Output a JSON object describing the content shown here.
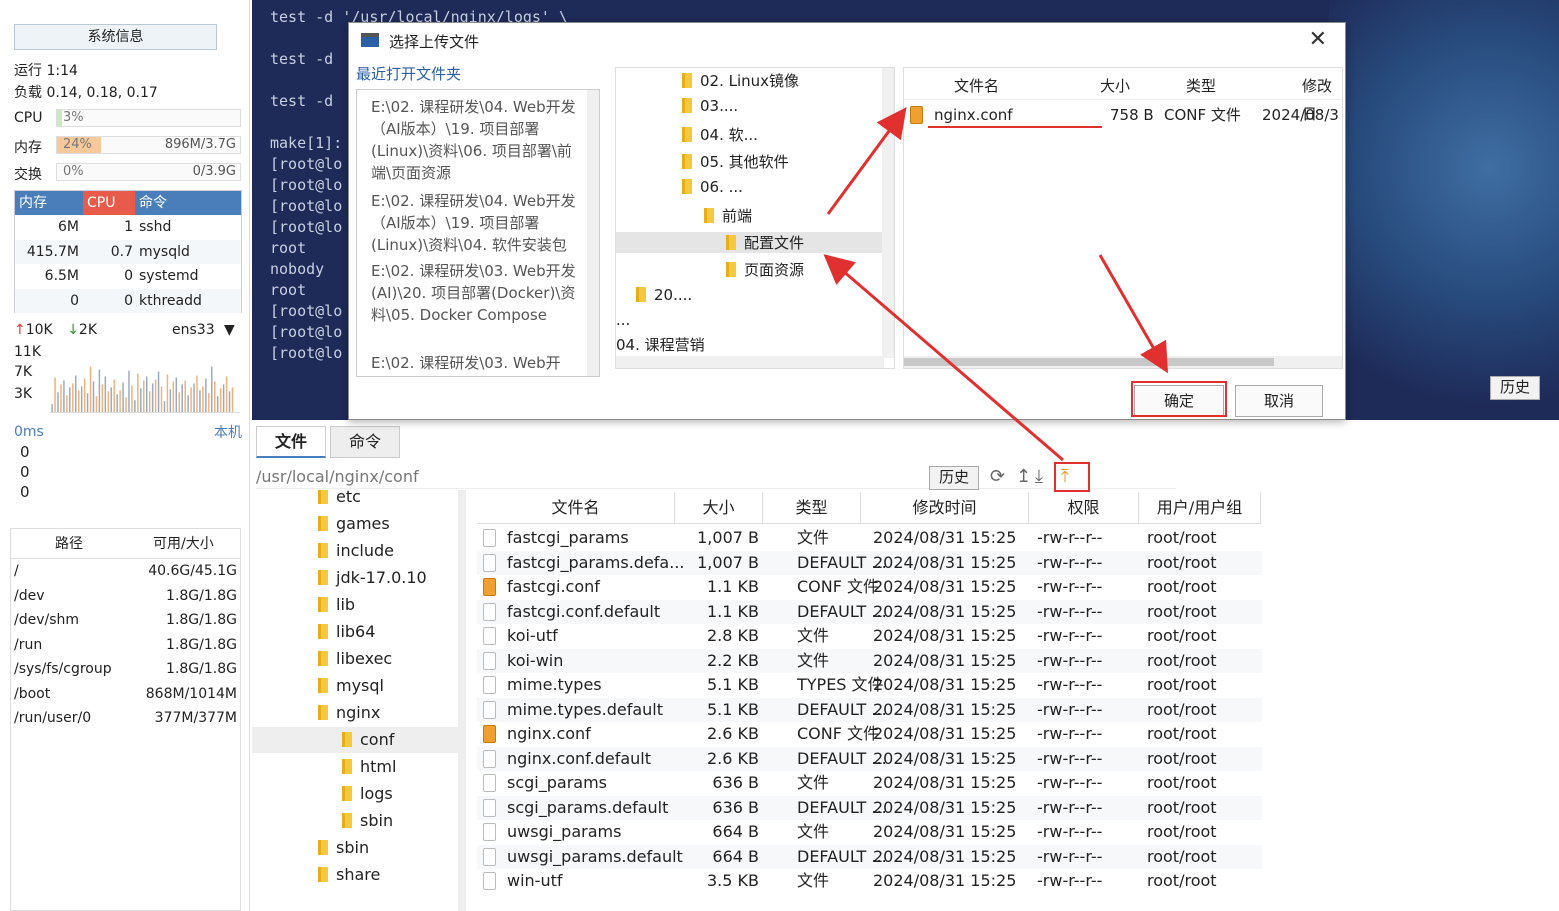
{
  "left": {
    "sysinfo_label": "系统信息",
    "uptime": "运行 1:14",
    "load": "负载 0.14, 0.18, 0.17",
    "cpu": {
      "label": "CPU",
      "pct": "3%",
      "fill": 0.03
    },
    "mem": {
      "label": "内存",
      "pct": "24%",
      "val": "896M/3.7G",
      "fill": 0.24
    },
    "swap": {
      "label": "交换",
      "pct": "0%",
      "val": "0/3.9G",
      "fill": 0
    },
    "proc_headers": [
      "内存",
      "CPU",
      "命令"
    ],
    "procs": [
      [
        "6M",
        "1",
        "sshd"
      ],
      [
        "415.7M",
        "0.7",
        "mysqld"
      ],
      [
        "6.5M",
        "0",
        "systemd"
      ],
      [
        "0",
        "0",
        "kthreadd"
      ]
    ],
    "net_up": "10K",
    "net_down": "2K",
    "iface": "ens33",
    "graph_ticks": [
      "11K",
      "7K",
      "3K"
    ],
    "ping": "0ms",
    "ping_host": "本机",
    "ping_vals": [
      "0",
      "0",
      "0"
    ],
    "disk_headers": [
      "路径",
      "可用/大小"
    ],
    "disks": [
      [
        "/",
        "40.6G/45.1G"
      ],
      [
        "/dev",
        "1.8G/1.8G"
      ],
      [
        "/dev/shm",
        "1.8G/1.8G"
      ],
      [
        "/run",
        "1.8G/1.8G"
      ],
      [
        "/sys/fs/cgroup",
        "1.8G/1.8G"
      ],
      [
        "/boot",
        "868M/1014M"
      ],
      [
        "/run/user/0",
        "377M/377M"
      ]
    ]
  },
  "terminal": {
    "lines": [
      "test -d '/usr/local/nginx/logs' \\",
      "test -d",
      "test -d",
      "make[1]:",
      "[root@lo",
      "[root@lo",
      "[root@lo",
      "[root@lo",
      "root",
      "nobody",
      "root",
      "[root@lo",
      "[root@lo",
      "[root@lo"
    ],
    "history_label": "历史"
  },
  "dialog": {
    "title": "选择上传文件",
    "recent_label": "最近打开文件夹",
    "recent": [
      "E:\\02. 课程研发\\04. Web开发（AI版本）\\19. 项目部署(Linux)\\资料\\06. 项目部署\\前端\\页面资源",
      "E:\\02. 课程研发\\04. Web开发（AI版本）\\19. 项目部署(Linux)\\资料\\04. 软件安装包",
      "E:\\02. 课程研发\\03. Web开发(AI)\\20. 项目部署(Docker)\\资料\\05. Docker Compose",
      "E:\\02. 课程研发\\03. Web开"
    ],
    "tree": [
      "02. Linux镜像",
      "03....",
      "04. 软...",
      "05. 其他软件",
      "06. ...",
      "前端",
      "配置文件",
      "页面资源",
      "20....",
      "...",
      "04. 课程营销"
    ],
    "file_headers": [
      "文件名",
      "大小",
      "类型",
      "修改日"
    ],
    "file": {
      "name": "nginx.conf",
      "size": "758 B",
      "type": "CONF 文件",
      "mtime": "2024/08/3"
    },
    "ok": "确定",
    "cancel": "取消"
  },
  "fm": {
    "tabs": [
      "文件",
      "命令"
    ],
    "path": "/usr/local/nginx/conf",
    "history": "历史",
    "tree": [
      "etc",
      "games",
      "include",
      "jdk-17.0.10",
      "lib",
      "lib64",
      "libexec",
      "mysql",
      "nginx",
      "conf",
      "html",
      "logs",
      "sbin",
      "sbin",
      "share"
    ],
    "headers": [
      "文件名",
      "大小",
      "类型",
      "修改时间",
      "权限",
      "用户/用户组"
    ],
    "rows": [
      [
        "fastcgi_params",
        "1,007 B",
        "文件",
        "2024/08/31 15:25",
        "-rw-r--r--",
        "root/root"
      ],
      [
        "fastcgi_params.defa...",
        "1,007 B",
        "DEFAULT ...",
        "2024/08/31 15:25",
        "-rw-r--r--",
        "root/root"
      ],
      [
        "fastcgi.conf",
        "1.1 KB",
        "CONF 文件",
        "2024/08/31 15:25",
        "-rw-r--r--",
        "root/root"
      ],
      [
        "fastcgi.conf.default",
        "1.1 KB",
        "DEFAULT ...",
        "2024/08/31 15:25",
        "-rw-r--r--",
        "root/root"
      ],
      [
        "koi-utf",
        "2.8 KB",
        "文件",
        "2024/08/31 15:25",
        "-rw-r--r--",
        "root/root"
      ],
      [
        "koi-win",
        "2.2 KB",
        "文件",
        "2024/08/31 15:25",
        "-rw-r--r--",
        "root/root"
      ],
      [
        "mime.types",
        "5.1 KB",
        "TYPES 文件",
        "2024/08/31 15:25",
        "-rw-r--r--",
        "root/root"
      ],
      [
        "mime.types.default",
        "5.1 KB",
        "DEFAULT ...",
        "2024/08/31 15:25",
        "-rw-r--r--",
        "root/root"
      ],
      [
        "nginx.conf",
        "2.6 KB",
        "CONF 文件",
        "2024/08/31 15:25",
        "-rw-r--r--",
        "root/root"
      ],
      [
        "nginx.conf.default",
        "2.6 KB",
        "DEFAULT ...",
        "2024/08/31 15:25",
        "-rw-r--r--",
        "root/root"
      ],
      [
        "scgi_params",
        "636 B",
        "文件",
        "2024/08/31 15:25",
        "-rw-r--r--",
        "root/root"
      ],
      [
        "scgi_params.default",
        "636 B",
        "DEFAULT ...",
        "2024/08/31 15:25",
        "-rw-r--r--",
        "root/root"
      ],
      [
        "uwsgi_params",
        "664 B",
        "文件",
        "2024/08/31 15:25",
        "-rw-r--r--",
        "root/root"
      ],
      [
        "uwsgi_params.default",
        "664 B",
        "DEFAULT ...",
        "2024/08/31 15:25",
        "-rw-r--r--",
        "root/root"
      ],
      [
        "win-utf",
        "3.5 KB",
        "文件",
        "2024/08/31 15:25",
        "-rw-r--r--",
        "root/root"
      ]
    ]
  },
  "colors": {
    "accent": "#4a7ebb",
    "annotation": "#e03030"
  }
}
